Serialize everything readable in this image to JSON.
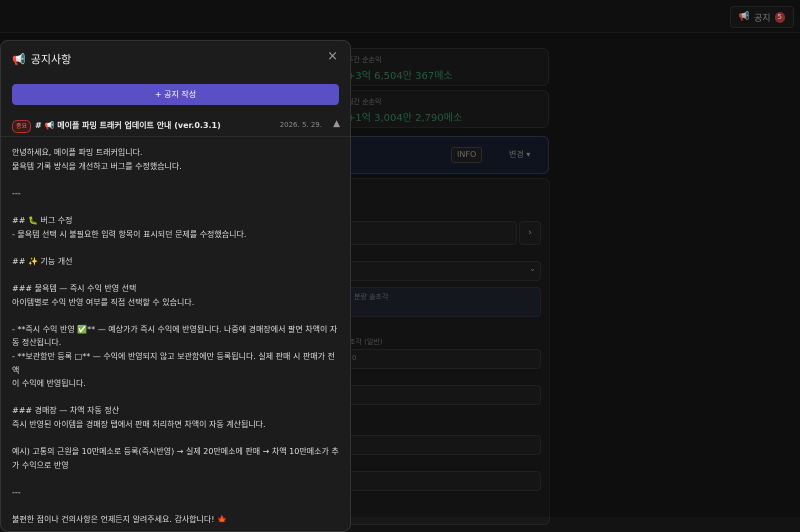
{
  "header": {
    "notice_label": "공지",
    "notice_count": "5"
  },
  "cards": [
    {
      "label": "주간 순손익",
      "value": "+3억 6,504만 367메소"
    },
    {
      "label": "월간 순손익",
      "value": "+1억 3,004만 2,790메소"
    }
  ],
  "info_card": {
    "chip_label": "INFO",
    "change_label": "변경 ▾"
  },
  "panel": {
    "hint_text": "분량 솔조각",
    "field_label": "조각 (일반)",
    "field_value": "0"
  },
  "modal": {
    "title": "공지사항",
    "write_button": "+ 공지 작성",
    "notice": {
      "badge": "중요",
      "title": "# 📢 메이플 파밍 트래커 업데이트 안내 (ver.0.3.1)",
      "date": "2026. 5. 29.",
      "toggle": "▲"
    },
    "body_lines": [
      "안녕하세요, 메이플 파밍 트래커입니다.",
      "물욕템 기록 방식을 개선하고 버그를 수정했습니다.",
      "",
      "---",
      "",
      "## 🐛 버그 수정",
      "- 물욕템 선택 시 불필요한 입력 항목이 표시되던 문제를 수정했습니다.",
      "",
      "## ✨ 기능 개선",
      "",
      "### 물욕템 — 즉시 수익 반영 선택",
      "아이템별로 수익 반영 여부를 직접 선택할 수 있습니다.",
      "",
      "- **즉시 수익 반영 ✅** — 예상가가 즉시 수익에 반영됩니다. 나중에 경매장에서 팔면 차액이 자",
      "동 정산됩니다.",
      "- **보관함만 등록 □** — 수익에 반영되지 않고 보관함에만 등록됩니다. 실제 판매 시 판매가 전액",
      "이 수익에 반영됩니다.",
      "",
      "### 경매장 — 차액 자동 정산",
      "즉시 반영된 아이템을 경매장 탭에서 판매 처리하면 차액이 자동 계산됩니다.",
      "",
      "예시) 고통의 근원을 10만메소로 등록(즉시반영) → 실제 20만메소에 판매 → 차액 10만메소가 추",
      "가 수익으로 반영",
      "",
      "---",
      "",
      "불편한 점이나 건의사항은 언제든지 알려주세요. 감사합니다! 🍁"
    ]
  }
}
